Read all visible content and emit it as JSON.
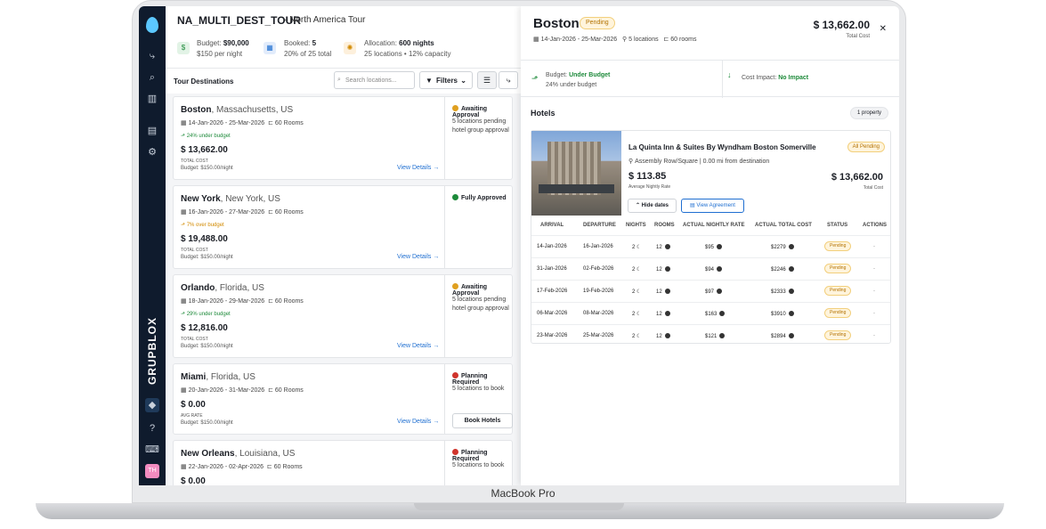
{
  "device": {
    "label": "MacBook Pro"
  },
  "sidebar": {
    "brand": "GRUPBLOX",
    "avatar_initials": "TH"
  },
  "header": {
    "tour_code": "NA_MULTI_DEST_TOUR",
    "tour_name": "· North America Tour",
    "budget": {
      "label": "Budget:",
      "value": "$90,000",
      "sub": "$150 per night"
    },
    "booked": {
      "label": "Booked:",
      "value": "5",
      "sub": "20% of 25 total"
    },
    "allocation": {
      "label": "Allocation:",
      "value": "600 nights",
      "sub": "25 locations • 12% capacity"
    }
  },
  "list": {
    "title": "Tour Destinations",
    "search_placeholder": "Search locations...",
    "filters_label": "Filters"
  },
  "destinations": [
    {
      "city": "Boston",
      "region": ", Massachusetts, US",
      "dates": "14-Jan-2026 - 25-Mar-2026",
      "rooms": "60 Rooms",
      "budget_note": "24% under budget",
      "note_color": "#1d8a3a",
      "cost": "$ 13,662.00",
      "cost_label": "TOTAL COST",
      "budget_line": "Budget: $150.00/night",
      "view": "View Details →",
      "status": "Awaiting Approval",
      "status_color": "#e0a020",
      "status_desc": "5 locations pending hotel group approval",
      "book": ""
    },
    {
      "city": "New York",
      "region": ", New York, US",
      "dates": "16-Jan-2026 - 27-Mar-2026",
      "rooms": "60 Rooms",
      "budget_note": "7% over budget",
      "note_color": "#d28a00",
      "cost": "$ 19,488.00",
      "cost_label": "TOTAL COST",
      "budget_line": "Budget: $150.00/night",
      "view": "View Details →",
      "status": "Fully Approved",
      "status_color": "#1d8a3a",
      "status_desc": "",
      "book": ""
    },
    {
      "city": "Orlando",
      "region": ", Florida, US",
      "dates": "18-Jan-2026 - 29-Mar-2026",
      "rooms": "60 Rooms",
      "budget_note": "29% under budget",
      "note_color": "#1d8a3a",
      "cost": "$ 12,816.00",
      "cost_label": "TOTAL COST",
      "budget_line": "Budget: $150.00/night",
      "view": "View Details →",
      "status": "Awaiting Approval",
      "status_color": "#e0a020",
      "status_desc": "5 locations pending hotel group approval",
      "book": ""
    },
    {
      "city": "Miami",
      "region": ", Florida, US",
      "dates": "20-Jan-2026 - 31-Mar-2026",
      "rooms": "60 Rooms",
      "budget_note": "",
      "note_color": "#1d8a3a",
      "cost": "$ 0.00",
      "cost_label": "AVG RATE",
      "budget_line": "Budget: $150.00/night",
      "view": "View Details →",
      "status": "Planning Required",
      "status_color": "#d0342c",
      "status_desc": "5 locations to book",
      "book": "Book Hotels"
    },
    {
      "city": "New Orleans",
      "region": ", Louisiana, US",
      "dates": "22-Jan-2026 - 02-Apr-2026",
      "rooms": "60 Rooms",
      "budget_note": "",
      "note_color": "#1d8a3a",
      "cost": "$ 0.00",
      "cost_label": "",
      "budget_line": "",
      "view": "",
      "status": "Planning Required",
      "status_color": "#d0342c",
      "status_desc": "5 locations to book",
      "book": ""
    }
  ],
  "panel": {
    "city": "Boston",
    "status": "Pending",
    "dates": "14-Jan-2026 - 25-Mar-2026",
    "locations": "5 locations",
    "rooms": "60 rooms",
    "total": "$ 13,662.00",
    "total_label": "Total Cost",
    "budget_label": "Budget:",
    "budget_value": "Under Budget",
    "budget_sub": "24% under budget",
    "impact_label": "Cost Impact:",
    "impact_value": "No Impact",
    "hotels_title": "Hotels",
    "property_count": "1 property",
    "hotel": {
      "name": "La Quinta Inn & Suites By Wyndham Boston Somerville",
      "badge": "All Pending",
      "address": "Assembly Row/Square | 0.00 mi from destination",
      "rate": "$ 113.85",
      "rate_label": "Average Nightly Rate",
      "total": "$ 13,662.00",
      "total_label": "Total Cost",
      "hide_label": "Hide dates",
      "agreement_label": "View Agreement"
    },
    "columns": [
      "ARRIVAL",
      "DEPARTURE",
      "NIGHTS",
      "ROOMS",
      "ACTUAL NIGHTLY RATE",
      "ACTUAL TOTAL COST",
      "STATUS",
      "ACTIONS"
    ],
    "rows": [
      {
        "arrival": "14-Jan-2026",
        "departure": "16-Jan-2026",
        "nights": "2",
        "rooms": "12",
        "rate": "$95",
        "cost": "$2279",
        "status": "Pending",
        "action": "-"
      },
      {
        "arrival": "31-Jan-2026",
        "departure": "02-Feb-2026",
        "nights": "2",
        "rooms": "12",
        "rate": "$94",
        "cost": "$2246",
        "status": "Pending",
        "action": "-"
      },
      {
        "arrival": "17-Feb-2026",
        "departure": "19-Feb-2026",
        "nights": "2",
        "rooms": "12",
        "rate": "$97",
        "cost": "$2333",
        "status": "Pending",
        "action": "-"
      },
      {
        "arrival": "06-Mar-2026",
        "departure": "08-Mar-2026",
        "nights": "2",
        "rooms": "12",
        "rate": "$163",
        "cost": "$3910",
        "status": "Pending",
        "action": "-"
      },
      {
        "arrival": "23-Mar-2026",
        "departure": "25-Mar-2026",
        "nights": "2",
        "rooms": "12",
        "rate": "$121",
        "cost": "$2894",
        "status": "Pending",
        "action": "-"
      }
    ]
  }
}
